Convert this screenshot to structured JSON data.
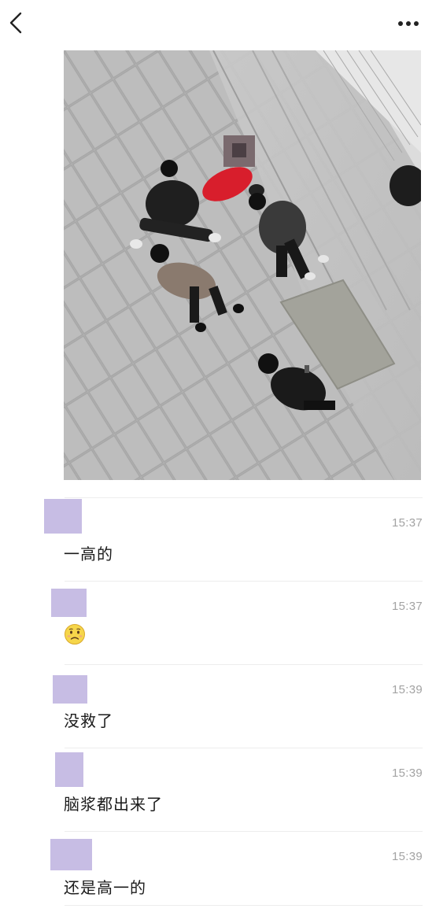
{
  "header": {
    "back_icon": "chevron-left-icon",
    "more_icon": "more-dots-icon"
  },
  "post": {
    "image": "street-scene-photo"
  },
  "messages": [
    {
      "time": "15:37",
      "text": "一高的"
    },
    {
      "time": "15:37",
      "text": "",
      "emoji": "worried-face-emoji"
    },
    {
      "time": "15:39",
      "text": "没救了"
    },
    {
      "time": "15:39",
      "text": "脑浆都出来了"
    },
    {
      "time": "15:39",
      "text": "还是高一的"
    }
  ],
  "colors": {
    "avatar_placeholder": "#c7bde4",
    "timestamp": "#a3a3a3",
    "divider": "#ededed",
    "red_jacket": "#d81e2c"
  }
}
